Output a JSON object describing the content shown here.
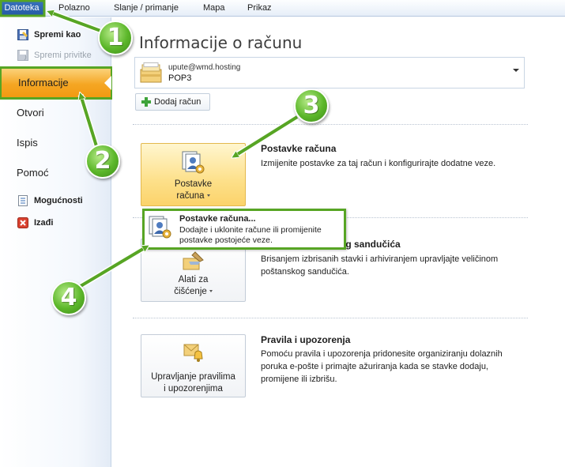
{
  "ribbon": {
    "tabs": [
      {
        "label": "Datoteka"
      },
      {
        "label": "Polazno"
      },
      {
        "label": "Slanje / primanje"
      },
      {
        "label": "Mapa"
      },
      {
        "label": "Prikaz"
      }
    ]
  },
  "nav": {
    "commands": [
      {
        "label": "Spremi kao",
        "icon": "save-as-icon"
      },
      {
        "label": "Spremi privitke",
        "icon": "save-attachments-icon"
      }
    ],
    "items": [
      {
        "label": "Informacije"
      },
      {
        "label": "Otvori"
      },
      {
        "label": "Ispis"
      },
      {
        "label": "Pomoć"
      }
    ],
    "bottom_commands": [
      {
        "label": "Mogućnosti",
        "icon": "options-icon"
      },
      {
        "label": "Izađi",
        "icon": "exit-icon"
      }
    ]
  },
  "main": {
    "title": "Informacije o računu",
    "account": {
      "email": "upute@wmd.hosting",
      "type": "POP3"
    },
    "add_account_label": "Dodaj račun",
    "sections": [
      {
        "button_line1": "Postavke",
        "button_line2": "računa",
        "title": "Postavke računa",
        "desc": "Izmijenite postavke za taj račun i konfigurirajte dodatne veze."
      },
      {
        "button_line1": "Alati za",
        "button_line2": "čišćenje",
        "title_partial": "og sandučića",
        "desc": "Brisanjem izbrisanih stavki i arhiviranjem upravljajte veličinom poštanskog sandučića."
      },
      {
        "button_line1": "Upravljanje pravilima",
        "button_line2": "i upozorenjima",
        "title": "Pravila i upozorenja",
        "desc": "Pomoću pravila i upozorenja pridonesite organiziranju dolaznih poruka e-pošte i primajte ažuriranja kada se stavke dodaju, promijene ili izbrišu."
      }
    ],
    "menu": {
      "title": "Postavke računa...",
      "desc": "Dodajte i uklonite račune ili promijenite postavke postojeće veze."
    }
  },
  "callouts": [
    "1",
    "2",
    "3",
    "4"
  ],
  "colors": {
    "highlight": "#57a524",
    "active_nav": "#f5a623",
    "file_tab": "#2a62ad"
  }
}
